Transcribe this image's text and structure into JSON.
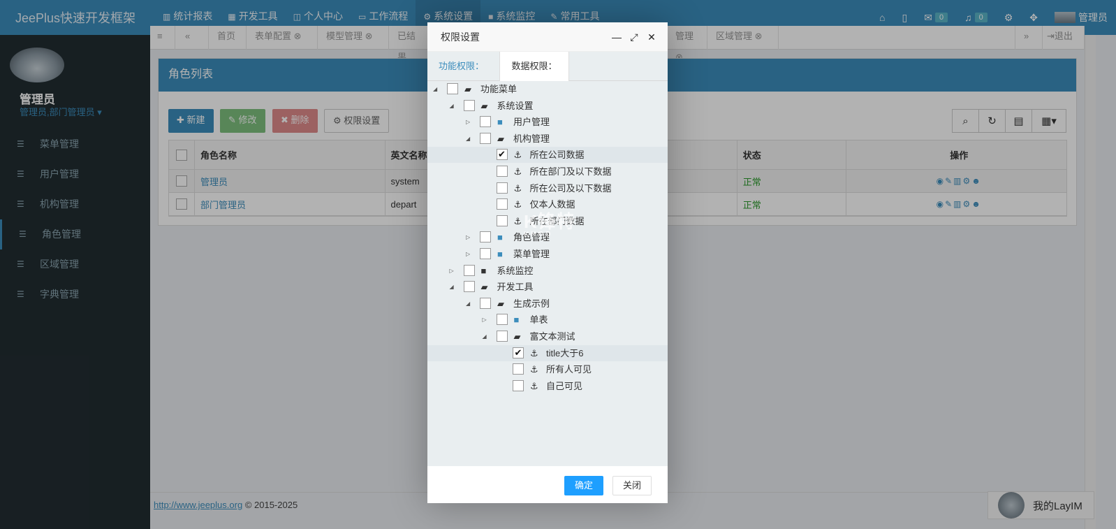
{
  "brand": "JeePlus快速开发框架",
  "topnav": [
    {
      "label": "统计报表",
      "icon": "chart-icon"
    },
    {
      "label": "开发工具",
      "icon": "grid-icon"
    },
    {
      "label": "个人中心",
      "icon": "columns-icon"
    },
    {
      "label": "工作流程",
      "icon": "monitor-icon"
    },
    {
      "label": "系统设置",
      "icon": "gear-icon"
    },
    {
      "label": "系统监控",
      "icon": "video-icon"
    },
    {
      "label": "常用工具",
      "icon": "wrench-icon"
    }
  ],
  "rightnav": {
    "mail_count": "0",
    "notify_count": "0",
    "user_label": "管理员"
  },
  "sidebar": {
    "user_name": "管理员",
    "user_roles": "管理员,部门管理员",
    "items": [
      {
        "label": "菜单管理"
      },
      {
        "label": "用户管理"
      },
      {
        "label": "机构管理"
      },
      {
        "label": "角色管理"
      },
      {
        "label": "区域管理"
      },
      {
        "label": "字典管理"
      }
    ]
  },
  "tabs": {
    "home": "首页",
    "t1": "表单配置",
    "t2": "模型管理",
    "t3": "已结果",
    "t4": "管理",
    "t5": "区域管理",
    "exit": "退出"
  },
  "panel": {
    "title": "角色列表",
    "btn_add": "新建",
    "btn_edit": "修改",
    "btn_delete": "删除",
    "btn_perm": "权限设置"
  },
  "table": {
    "headers": {
      "name": "角色名称",
      "en": "英文名称",
      "status": "状态",
      "ops": "操作"
    },
    "rows": [
      {
        "name": "管理员",
        "en": "system",
        "status": "正常"
      },
      {
        "name": "部门管理员",
        "en": "depart",
        "status": "正常"
      }
    ]
  },
  "footer": {
    "url": "http://www.jeeplus.org",
    "copyright": "© 2015-2025"
  },
  "layim": "我的LayIM",
  "dialog": {
    "title": "权限设置",
    "tab_func": "功能权限：",
    "tab_data": "数据权限：",
    "ok": "确定",
    "close": "关闭",
    "tree": [
      {
        "label": "功能菜单",
        "level": 0,
        "exp": "open",
        "icon": "folder-open",
        "checked": false
      },
      {
        "label": "系统设置",
        "level": 1,
        "exp": "open",
        "icon": "folder-open",
        "checked": false
      },
      {
        "label": "用户管理",
        "level": 2,
        "exp": "closed",
        "icon": "folder",
        "checked": false
      },
      {
        "label": "机构管理",
        "level": 2,
        "exp": "open",
        "icon": "folder-open",
        "checked": false
      },
      {
        "label": "所在公司数据",
        "level": 3,
        "exp": "none",
        "icon": "anchor",
        "checked": true
      },
      {
        "label": "所在部门及以下数据",
        "level": 3,
        "exp": "none",
        "icon": "anchor",
        "checked": false
      },
      {
        "label": "所在公司及以下数据",
        "level": 3,
        "exp": "none",
        "icon": "anchor",
        "checked": false
      },
      {
        "label": "仅本人数据",
        "level": 3,
        "exp": "none",
        "icon": "anchor",
        "checked": false
      },
      {
        "label": "所在部门数据",
        "level": 3,
        "exp": "none",
        "icon": "anchor",
        "checked": false
      },
      {
        "label": "角色管理",
        "level": 2,
        "exp": "closed",
        "icon": "folder",
        "checked": false
      },
      {
        "label": "菜单管理",
        "level": 2,
        "exp": "closed",
        "icon": "folder",
        "checked": false
      },
      {
        "label": "系统监控",
        "level": 1,
        "exp": "closed",
        "icon": "video",
        "checked": false
      },
      {
        "label": "开发工具",
        "level": 1,
        "exp": "open",
        "icon": "folder-open",
        "checked": false
      },
      {
        "label": "生成示例",
        "level": 2,
        "exp": "open",
        "icon": "folder-open",
        "checked": false
      },
      {
        "label": "单表",
        "level": 3,
        "exp": "closed",
        "icon": "folder",
        "checked": false
      },
      {
        "label": "富文本测试",
        "level": 3,
        "exp": "open",
        "icon": "folder-open",
        "checked": false
      },
      {
        "label": "title大于6",
        "level": 4,
        "exp": "none",
        "icon": "anchor",
        "checked": true
      },
      {
        "label": "所有人可见",
        "level": 4,
        "exp": "none",
        "icon": "anchor",
        "checked": false
      },
      {
        "label": "自己可见",
        "level": 4,
        "exp": "none",
        "icon": "anchor",
        "checked": false
      }
    ],
    "watermark": "K锋特",
    "watermark_sub": "KHOD"
  },
  "colors": {
    "primary": "#3c8dbc",
    "ok_button": "#1e9fff",
    "status_ok": "#2b9a2b"
  }
}
